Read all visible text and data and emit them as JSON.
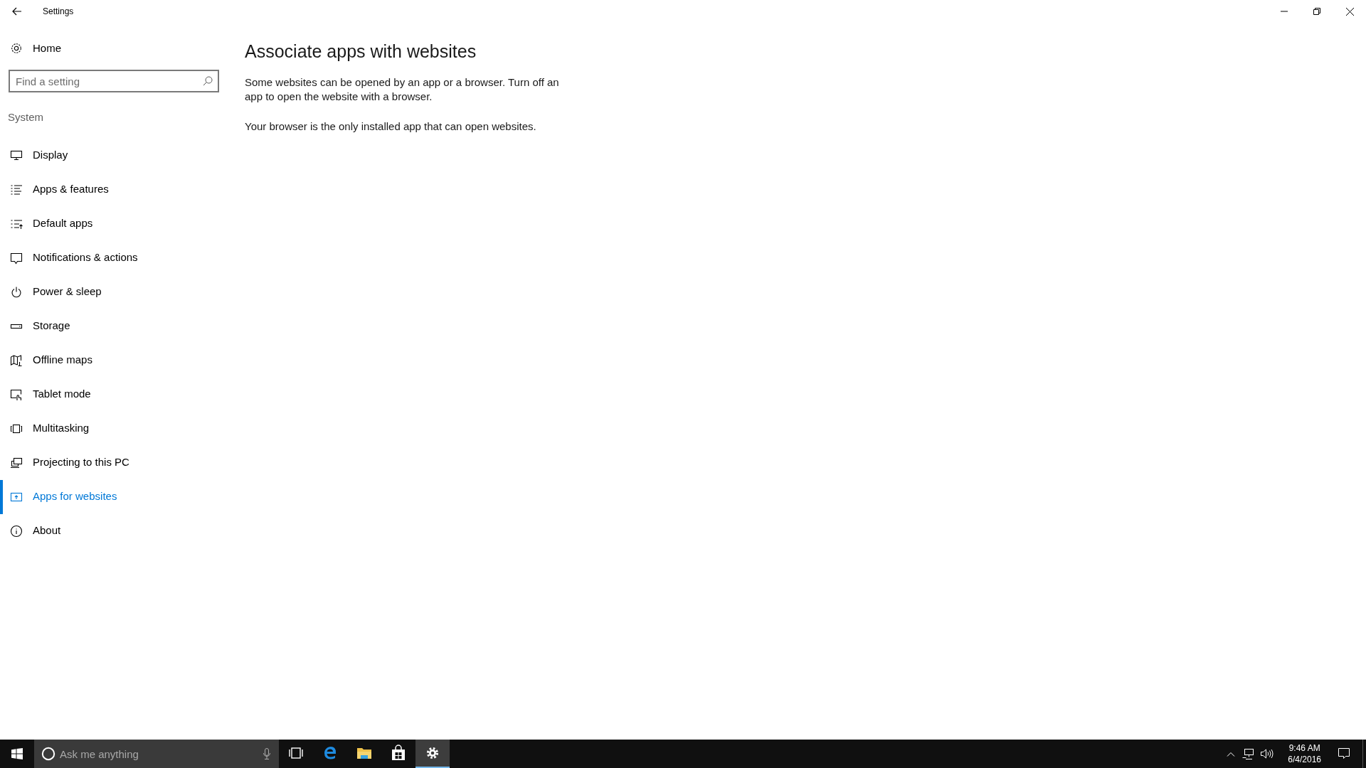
{
  "window": {
    "title": "Settings"
  },
  "sidebar": {
    "home": "Home",
    "search": {
      "placeholder": "Find a setting"
    },
    "section": "System",
    "items": [
      {
        "label": "Display",
        "kind": "display",
        "selected": false
      },
      {
        "label": "Apps & features",
        "kind": "list",
        "selected": false
      },
      {
        "label": "Default apps",
        "kind": "default",
        "selected": false
      },
      {
        "label": "Notifications & actions",
        "kind": "notify",
        "selected": false
      },
      {
        "label": "Power & sleep",
        "kind": "power",
        "selected": false
      },
      {
        "label": "Storage",
        "kind": "storage",
        "selected": false
      },
      {
        "label": "Offline maps",
        "kind": "map",
        "selected": false
      },
      {
        "label": "Tablet mode",
        "kind": "tablet",
        "selected": false
      },
      {
        "label": "Multitasking",
        "kind": "multi",
        "selected": false
      },
      {
        "label": "Projecting to this PC",
        "kind": "project",
        "selected": false
      },
      {
        "label": "Apps for websites",
        "kind": "web",
        "selected": true
      },
      {
        "label": "About",
        "kind": "about",
        "selected": false
      }
    ]
  },
  "content": {
    "title": "Associate apps with websites",
    "paragraphs": [
      "Some websites can be opened by an app or a browser.  Turn off an app to open the website with a browser.",
      "Your browser is the only installed app that can open websites."
    ]
  },
  "taskbar": {
    "search": {
      "placeholder": "Ask me anything"
    },
    "apps": [
      {
        "kind": "taskview",
        "selected": false
      },
      {
        "kind": "edge",
        "selected": false
      },
      {
        "kind": "explorer",
        "selected": false
      },
      {
        "kind": "store",
        "selected": false
      },
      {
        "kind": "settings",
        "selected": true
      }
    ],
    "time": "9:46 AM",
    "date": "6/4/2016"
  }
}
